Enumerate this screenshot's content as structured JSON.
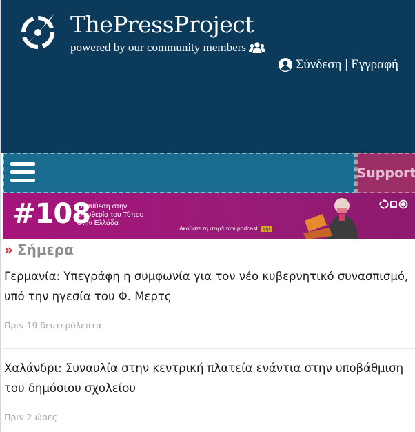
{
  "header": {
    "site_title": "ThePressProject",
    "tagline": "powered by our community members",
    "login_label": "Σύνδεση",
    "separator": "|",
    "register_label": "Εγγραφή",
    "background_color": "#0c3a5a"
  },
  "nav": {
    "menu_icon": "hamburger-menu-icon",
    "support_label": "Support",
    "nav_color": "#196c8f",
    "support_color": "#9b2e67"
  },
  "banner": {
    "episode": "#108",
    "headline": "Η επίθεση στην ελευθερία του Τύπου στην Ελλάδα",
    "subline": "Ακούστε τη σειρά των podcast",
    "subline_badge": "tpp"
  },
  "section": {
    "arrow": "»",
    "title": "Σήμερα"
  },
  "articles": [
    {
      "title": "Γερμανία: Υπεγράφη η συμφωνία για τον νέο κυβερνητικό συνασπισμό, υπό την ηγεσία του Φ. Μερτς",
      "time": "Πριν 19 δευτερόλεπτα"
    },
    {
      "title": "Χαλάνδρι: Συναυλία στην κεντρική πλατεία ενάντια στην υποβάθμιση του δημόσιου σχολείου",
      "time": "Πριν 2 ώρες"
    }
  ]
}
